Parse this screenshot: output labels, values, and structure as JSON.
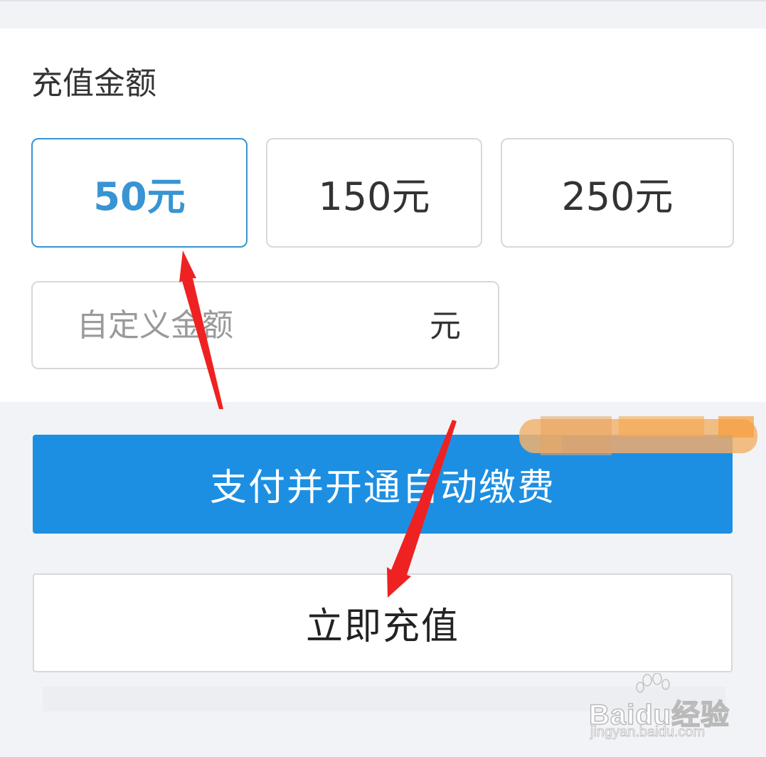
{
  "recharge": {
    "title": "充值金额",
    "amount_options": [
      {
        "label": "50元",
        "selected": true
      },
      {
        "label": "150元",
        "selected": false
      },
      {
        "label": "250元",
        "selected": false
      }
    ],
    "custom_amount": {
      "placeholder": "自定义金额",
      "unit": "元"
    }
  },
  "actions": {
    "auto_pay_label": "支付并开通自动缴费",
    "recharge_now_label": "立即充值"
  },
  "colors": {
    "accent": "#3894d3",
    "primary_button": "#1d8fe2",
    "annotation_arrow": "#ee2222"
  },
  "watermark": {
    "brand": "Baidu经验",
    "url": "jingyan.baidu.com"
  }
}
